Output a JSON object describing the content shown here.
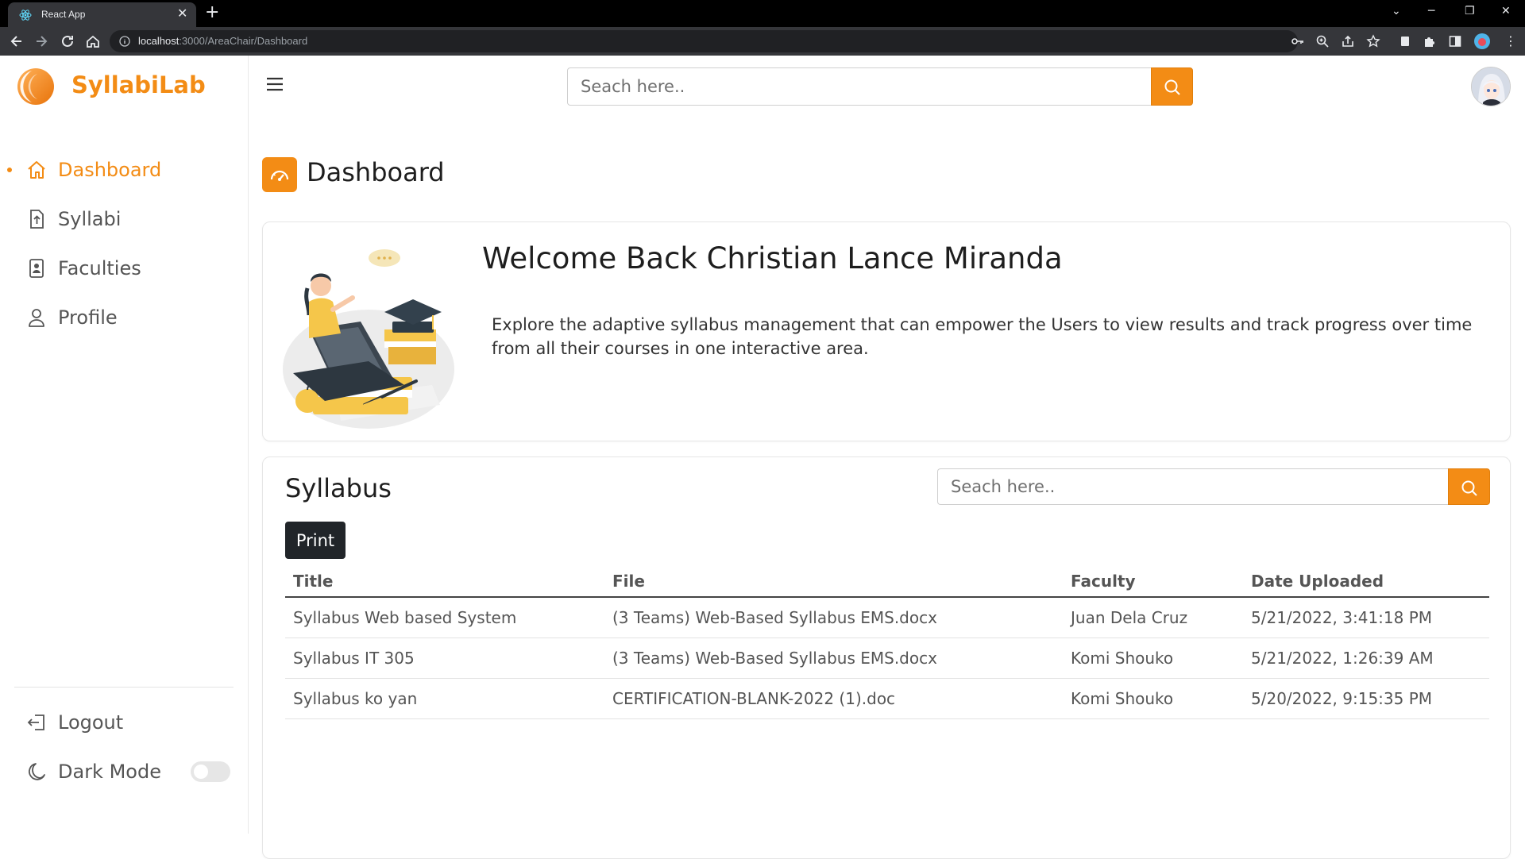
{
  "browser": {
    "tab_title": "React App",
    "url_host": "localhost",
    "url_rest": ":3000/AreaChair/Dashboard"
  },
  "app": {
    "brand": "SyllabiLab",
    "accent_color": "#f38c15"
  },
  "sidebar": {
    "items": [
      {
        "label": "Dashboard",
        "icon": "home-icon",
        "active": true
      },
      {
        "label": "Syllabi",
        "icon": "upload-file-icon",
        "active": false
      },
      {
        "label": "Faculties",
        "icon": "id-badge-icon",
        "active": false
      },
      {
        "label": "Profile",
        "icon": "user-icon",
        "active": false
      }
    ],
    "logout_label": "Logout",
    "dark_mode_label": "Dark Mode",
    "dark_mode_on": false
  },
  "header": {
    "search_placeholder": "Seach here.."
  },
  "page": {
    "title": "Dashboard"
  },
  "welcome": {
    "title": "Welcome Back Christian Lance Miranda",
    "text": "Explore the adaptive syllabus management that can empower the Users to view results and track progress over time from all their courses in one interactive area."
  },
  "syllabus": {
    "title": "Syllabus",
    "search_placeholder": "Seach here..",
    "print_label": "Print",
    "columns": [
      "Title",
      "File",
      "Faculty",
      "Date Uploaded"
    ],
    "rows": [
      [
        "Syllabus Web based System",
        "(3 Teams) Web-Based Syllabus EMS.docx",
        "Juan Dela Cruz",
        "5/21/2022, 3:41:18 PM"
      ],
      [
        "Syllabus IT 305",
        "(3 Teams) Web-Based Syllabus EMS.docx",
        "Komi Shouko",
        "5/21/2022, 1:26:39 AM"
      ],
      [
        "Syllabus ko yan",
        "CERTIFICATION-BLANK-2022 (1).doc",
        "Komi Shouko",
        "5/20/2022, 9:15:35 PM"
      ]
    ]
  }
}
